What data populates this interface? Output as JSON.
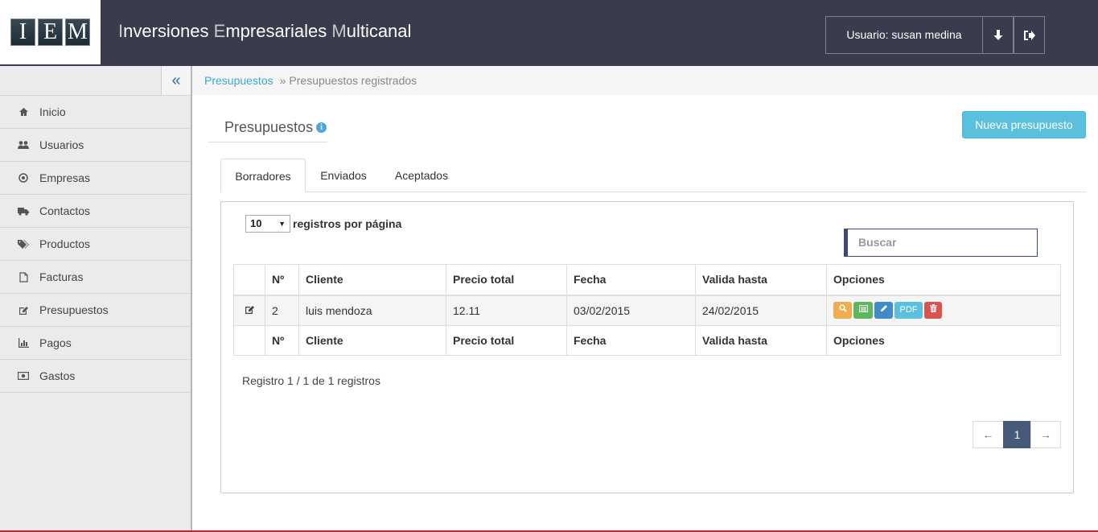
{
  "header": {
    "logo_letters": [
      "I",
      "E",
      "M"
    ],
    "title_parts": [
      {
        "initial": "I",
        "rest": "nversiones "
      },
      {
        "initial": "E",
        "rest": "mpresariales "
      },
      {
        "initial": "M",
        "rest": "ulticanal"
      }
    ],
    "user_label": "Usuario: susan medina",
    "download_icon": "arrow-down-icon",
    "logout_icon": "sign-out-icon"
  },
  "sidebar": {
    "collapse_glyph": "«",
    "items": [
      {
        "label": "Inicio",
        "icon": "home-icon"
      },
      {
        "label": "Usuarios",
        "icon": "users-icon"
      },
      {
        "label": "Empresas",
        "icon": "circle-dot-icon"
      },
      {
        "label": "Contactos",
        "icon": "truck-icon"
      },
      {
        "label": "Productos",
        "icon": "tags-icon"
      },
      {
        "label": "Facturas",
        "icon": "file-icon"
      },
      {
        "label": "Presupuestos",
        "icon": "edit-icon"
      },
      {
        "label": "Pagos",
        "icon": "bar-chart-icon"
      },
      {
        "label": "Gastos",
        "icon": "money-icon"
      }
    ]
  },
  "breadcrumb": {
    "link": "Presupuestos",
    "separator": "»",
    "current": "Presupuestos registrados"
  },
  "page": {
    "title": "Presupuestos",
    "info_glyph": "i",
    "new_button": "Nueva presupuesto"
  },
  "tabs": [
    "Borradores",
    "Enviados",
    "Aceptados"
  ],
  "table_controls": {
    "page_length": "10",
    "length_label": "registros por página",
    "search_placeholder": "Buscar"
  },
  "table": {
    "columns": [
      "Nº",
      "Cliente",
      "Precio total",
      "Fecha",
      "Valida hasta",
      "Opciones"
    ],
    "rows": [
      {
        "num": "2",
        "client": "luis mendoza",
        "total": "12.11",
        "date": "03/02/2015",
        "valid_until": "24/02/2015"
      }
    ],
    "option_buttons": [
      {
        "name": "view-button",
        "icon": "search-icon",
        "color": "#f0ad4e"
      },
      {
        "name": "list-button",
        "icon": "list-icon",
        "color": "#5cb85c"
      },
      {
        "name": "edit-button",
        "icon": "pencil-icon",
        "color": "#428bca"
      },
      {
        "name": "pdf-button",
        "label": "PDF",
        "color": "#5bc0de"
      },
      {
        "name": "delete-button",
        "icon": "trash-icon",
        "color": "#d9534f"
      }
    ]
  },
  "info_text": "Registro 1 / 1 de 1 registros",
  "pagination": {
    "prev": "←",
    "current": "1",
    "next": "→"
  },
  "colors": {
    "topbar": "#383c4c",
    "accent": "#5bc0de",
    "link": "#3aa9d6",
    "active_page": "#485a7a"
  }
}
